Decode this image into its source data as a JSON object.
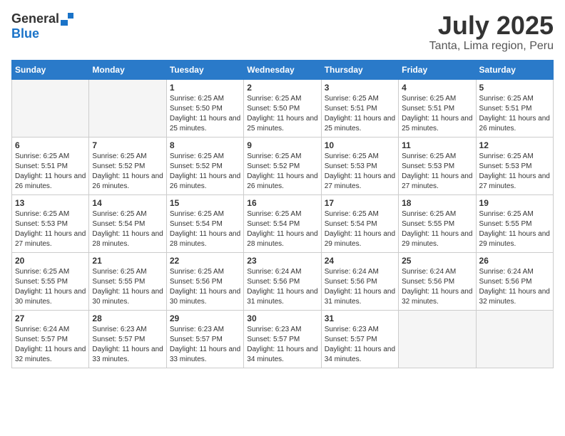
{
  "header": {
    "logo_general": "General",
    "logo_blue": "Blue",
    "month_title": "July 2025",
    "location": "Tanta, Lima region, Peru"
  },
  "calendar": {
    "weekdays": [
      "Sunday",
      "Monday",
      "Tuesday",
      "Wednesday",
      "Thursday",
      "Friday",
      "Saturday"
    ],
    "weeks": [
      [
        {
          "day": "",
          "info": ""
        },
        {
          "day": "",
          "info": ""
        },
        {
          "day": "1",
          "info": "Sunrise: 6:25 AM\nSunset: 5:50 PM\nDaylight: 11 hours and 25 minutes."
        },
        {
          "day": "2",
          "info": "Sunrise: 6:25 AM\nSunset: 5:50 PM\nDaylight: 11 hours and 25 minutes."
        },
        {
          "day": "3",
          "info": "Sunrise: 6:25 AM\nSunset: 5:51 PM\nDaylight: 11 hours and 25 minutes."
        },
        {
          "day": "4",
          "info": "Sunrise: 6:25 AM\nSunset: 5:51 PM\nDaylight: 11 hours and 25 minutes."
        },
        {
          "day": "5",
          "info": "Sunrise: 6:25 AM\nSunset: 5:51 PM\nDaylight: 11 hours and 26 minutes."
        }
      ],
      [
        {
          "day": "6",
          "info": "Sunrise: 6:25 AM\nSunset: 5:51 PM\nDaylight: 11 hours and 26 minutes."
        },
        {
          "day": "7",
          "info": "Sunrise: 6:25 AM\nSunset: 5:52 PM\nDaylight: 11 hours and 26 minutes."
        },
        {
          "day": "8",
          "info": "Sunrise: 6:25 AM\nSunset: 5:52 PM\nDaylight: 11 hours and 26 minutes."
        },
        {
          "day": "9",
          "info": "Sunrise: 6:25 AM\nSunset: 5:52 PM\nDaylight: 11 hours and 26 minutes."
        },
        {
          "day": "10",
          "info": "Sunrise: 6:25 AM\nSunset: 5:53 PM\nDaylight: 11 hours and 27 minutes."
        },
        {
          "day": "11",
          "info": "Sunrise: 6:25 AM\nSunset: 5:53 PM\nDaylight: 11 hours and 27 minutes."
        },
        {
          "day": "12",
          "info": "Sunrise: 6:25 AM\nSunset: 5:53 PM\nDaylight: 11 hours and 27 minutes."
        }
      ],
      [
        {
          "day": "13",
          "info": "Sunrise: 6:25 AM\nSunset: 5:53 PM\nDaylight: 11 hours and 27 minutes."
        },
        {
          "day": "14",
          "info": "Sunrise: 6:25 AM\nSunset: 5:54 PM\nDaylight: 11 hours and 28 minutes."
        },
        {
          "day": "15",
          "info": "Sunrise: 6:25 AM\nSunset: 5:54 PM\nDaylight: 11 hours and 28 minutes."
        },
        {
          "day": "16",
          "info": "Sunrise: 6:25 AM\nSunset: 5:54 PM\nDaylight: 11 hours and 28 minutes."
        },
        {
          "day": "17",
          "info": "Sunrise: 6:25 AM\nSunset: 5:54 PM\nDaylight: 11 hours and 29 minutes."
        },
        {
          "day": "18",
          "info": "Sunrise: 6:25 AM\nSunset: 5:55 PM\nDaylight: 11 hours and 29 minutes."
        },
        {
          "day": "19",
          "info": "Sunrise: 6:25 AM\nSunset: 5:55 PM\nDaylight: 11 hours and 29 minutes."
        }
      ],
      [
        {
          "day": "20",
          "info": "Sunrise: 6:25 AM\nSunset: 5:55 PM\nDaylight: 11 hours and 30 minutes."
        },
        {
          "day": "21",
          "info": "Sunrise: 6:25 AM\nSunset: 5:55 PM\nDaylight: 11 hours and 30 minutes."
        },
        {
          "day": "22",
          "info": "Sunrise: 6:25 AM\nSunset: 5:56 PM\nDaylight: 11 hours and 30 minutes."
        },
        {
          "day": "23",
          "info": "Sunrise: 6:24 AM\nSunset: 5:56 PM\nDaylight: 11 hours and 31 minutes."
        },
        {
          "day": "24",
          "info": "Sunrise: 6:24 AM\nSunset: 5:56 PM\nDaylight: 11 hours and 31 minutes."
        },
        {
          "day": "25",
          "info": "Sunrise: 6:24 AM\nSunset: 5:56 PM\nDaylight: 11 hours and 32 minutes."
        },
        {
          "day": "26",
          "info": "Sunrise: 6:24 AM\nSunset: 5:56 PM\nDaylight: 11 hours and 32 minutes."
        }
      ],
      [
        {
          "day": "27",
          "info": "Sunrise: 6:24 AM\nSunset: 5:57 PM\nDaylight: 11 hours and 32 minutes."
        },
        {
          "day": "28",
          "info": "Sunrise: 6:23 AM\nSunset: 5:57 PM\nDaylight: 11 hours and 33 minutes."
        },
        {
          "day": "29",
          "info": "Sunrise: 6:23 AM\nSunset: 5:57 PM\nDaylight: 11 hours and 33 minutes."
        },
        {
          "day": "30",
          "info": "Sunrise: 6:23 AM\nSunset: 5:57 PM\nDaylight: 11 hours and 34 minutes."
        },
        {
          "day": "31",
          "info": "Sunrise: 6:23 AM\nSunset: 5:57 PM\nDaylight: 11 hours and 34 minutes."
        },
        {
          "day": "",
          "info": ""
        },
        {
          "day": "",
          "info": ""
        }
      ]
    ]
  }
}
